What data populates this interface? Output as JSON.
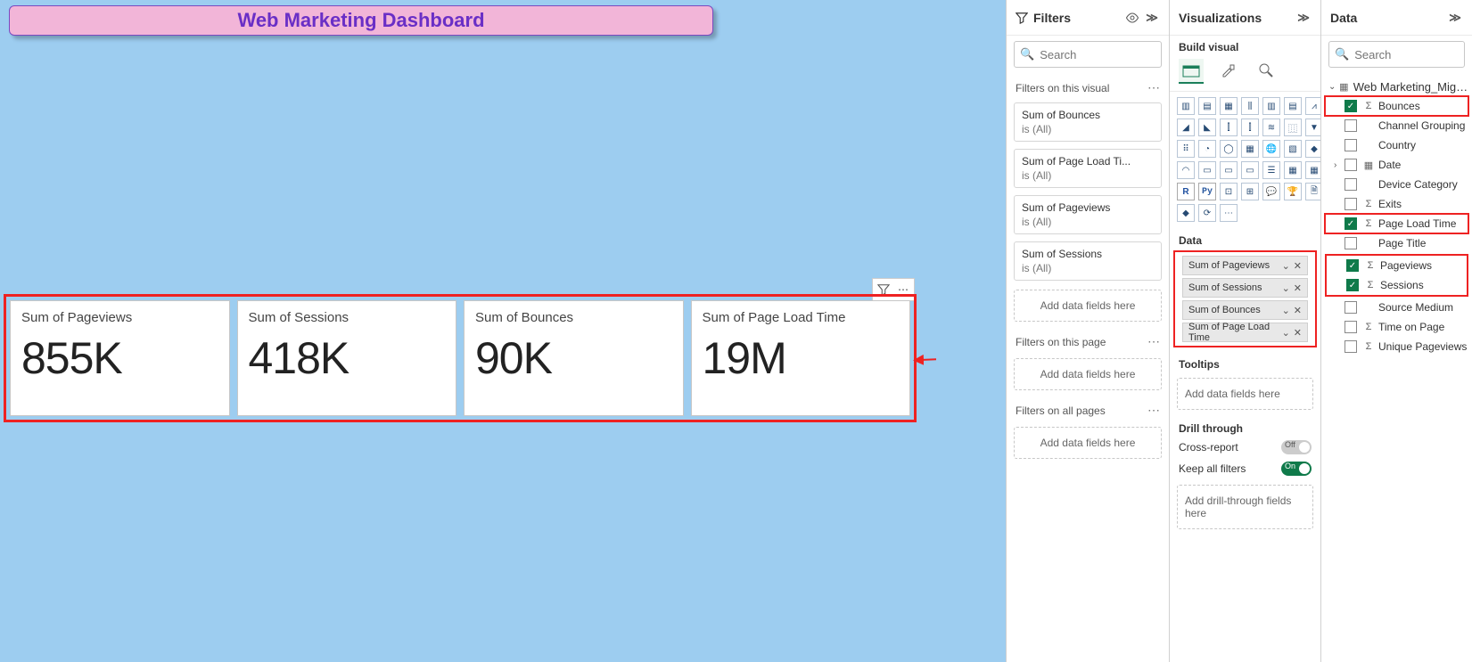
{
  "canvas": {
    "title": "Web Marketing Dashboard",
    "cards": [
      {
        "label": "Sum of Pageviews",
        "value": "855K"
      },
      {
        "label": "Sum of Sessions",
        "value": "418K"
      },
      {
        "label": "Sum of Bounces",
        "value": "90K"
      },
      {
        "label": "Sum of Page Load Time",
        "value": "19M"
      }
    ]
  },
  "filters": {
    "title": "Filters",
    "search_placeholder": "Search",
    "on_visual_label": "Filters on this visual",
    "visual_filters": [
      {
        "name": "Sum of Bounces",
        "sub": "is (All)"
      },
      {
        "name": "Sum of Page Load Ti...",
        "sub": "is (All)"
      },
      {
        "name": "Sum of Pageviews",
        "sub": "is (All)"
      },
      {
        "name": "Sum of Sessions",
        "sub": "is (All)"
      }
    ],
    "add_visual": "Add data fields here",
    "on_page_label": "Filters on this page",
    "add_page": "Add data fields here",
    "on_all_label": "Filters on all pages",
    "add_all": "Add data fields here"
  },
  "viz": {
    "title": "Visualizations",
    "build_label": "Build visual",
    "data_label": "Data",
    "field_pills": [
      "Sum of Pageviews",
      "Sum of Sessions",
      "Sum of Bounces",
      "Sum of Page Load Time"
    ],
    "tooltips_label": "Tooltips",
    "tooltips_well": "Add data fields here",
    "drill_label": "Drill through",
    "cross_report_label": "Cross-report",
    "cross_report_state": "Off",
    "keep_filters_label": "Keep all filters",
    "keep_filters_state": "On",
    "drill_well": "Add drill-through fields here"
  },
  "data": {
    "title": "Data",
    "search_placeholder": "Search",
    "table_name": "Web Marketing_Migrat...",
    "fields": [
      {
        "name": "Bounces",
        "checked": true,
        "icon": "Σ",
        "hl": true
      },
      {
        "name": "Channel Grouping",
        "checked": false,
        "icon": ""
      },
      {
        "name": "Country",
        "checked": false,
        "icon": ""
      },
      {
        "name": "Date",
        "checked": false,
        "icon": "▦",
        "expandable": true
      },
      {
        "name": "Device Category",
        "checked": false,
        "icon": ""
      },
      {
        "name": "Exits",
        "checked": false,
        "icon": "Σ"
      },
      {
        "name": "Page Load Time",
        "checked": true,
        "icon": "Σ",
        "hl": true
      },
      {
        "name": "Page Title",
        "checked": false,
        "icon": ""
      },
      {
        "name": "Pageviews",
        "checked": true,
        "icon": "Σ",
        "hl_group": "a"
      },
      {
        "name": "Sessions",
        "checked": true,
        "icon": "Σ",
        "hl_group": "a"
      },
      {
        "name": "Source Medium",
        "checked": false,
        "icon": ""
      },
      {
        "name": "Time on Page",
        "checked": false,
        "icon": "Σ"
      },
      {
        "name": "Unique Pageviews",
        "checked": false,
        "icon": "Σ"
      }
    ]
  }
}
